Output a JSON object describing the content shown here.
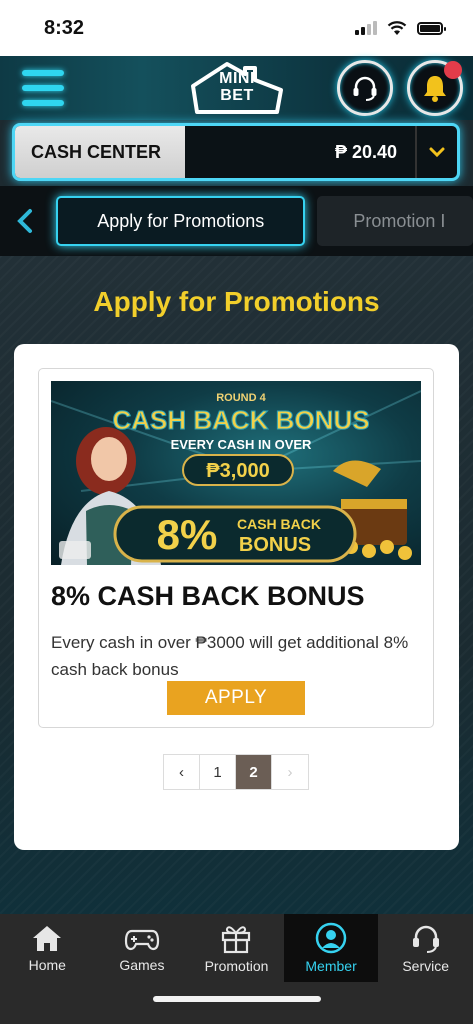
{
  "status_bar": {
    "time": "8:32"
  },
  "header": {
    "logo_line1": "MINI",
    "logo_line2": "BET"
  },
  "cash_center": {
    "label": "CASH CENTER",
    "amount": "₱ 20.40"
  },
  "tabs": [
    {
      "label": "Apply for Promotions",
      "active": true
    },
    {
      "label": "Promotion I",
      "active": false
    }
  ],
  "page": {
    "title": "Apply for Promotions"
  },
  "promo": {
    "banner": {
      "round": "ROUND 4",
      "headline": "CASH BACK BONUS",
      "sub": "EVERY CASH IN OVER",
      "amount": "₱3,000",
      "percent": "8%",
      "badge_line1": "CASH BACK",
      "badge_line2": "BONUS"
    },
    "title": "8% CASH BACK BONUS",
    "description": "Every cash in over ₱3000 will get additional 8% cash back bonus",
    "apply_label": "APPLY"
  },
  "pagination": {
    "prev": "‹",
    "pages": [
      "1",
      "2"
    ],
    "current": "2",
    "next": "›"
  },
  "bottom_nav": [
    {
      "label": "Home",
      "icon": "home-icon"
    },
    {
      "label": "Games",
      "icon": "gamepad-icon"
    },
    {
      "label": "Promotion",
      "icon": "gift-icon"
    },
    {
      "label": "Member",
      "icon": "member-icon",
      "active": true
    },
    {
      "label": "Service",
      "icon": "headset-icon"
    }
  ],
  "colors": {
    "accent_cyan": "#36d2f0",
    "title_yellow": "#f2cf2b",
    "apply_orange": "#e9a320",
    "notification_red": "#e23c4a"
  }
}
